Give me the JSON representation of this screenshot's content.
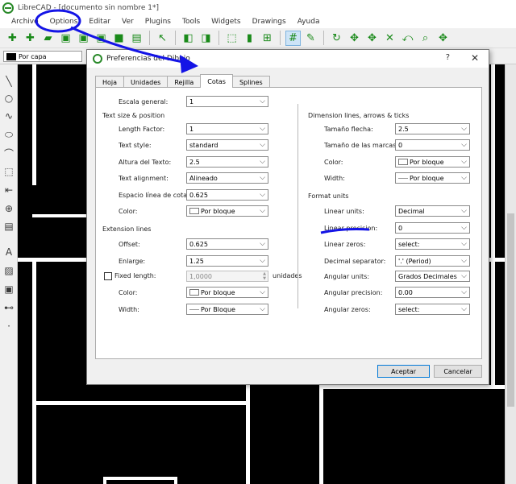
{
  "window": {
    "title": "LibreCAD - [documento sin nombre 1*]"
  },
  "menu": [
    "Archivo",
    "Options",
    "Editar",
    "Ver",
    "Plugins",
    "Tools",
    "Widgets",
    "Drawings",
    "Ayuda"
  ],
  "layer": {
    "value": "Por capa"
  },
  "dialog": {
    "title": "Preferencias del Dibujo",
    "help": "?",
    "close": "✕",
    "tabs": [
      "Hoja",
      "Unidades",
      "Rejilla",
      "Cotas",
      "Splines"
    ],
    "active_tab": "Cotas",
    "general": {
      "label": "Escala general:",
      "value": "1"
    },
    "text_section": {
      "title": "Text size & position",
      "length_factor": {
        "label": "Length Factor:",
        "value": "1"
      },
      "text_style": {
        "label": "Text style:",
        "value": "standard"
      },
      "text_height": {
        "label": "Altura del Texto:",
        "value": "2.5"
      },
      "text_alignment": {
        "label": "Text alignment:",
        "value": "Alineado"
      },
      "line_spacing": {
        "label": "Espacio línea de cota:",
        "value": "0.625"
      },
      "color": {
        "label": "Color:",
        "value": "Por bloque"
      }
    },
    "extension_section": {
      "title": "Extension lines",
      "offset": {
        "label": "Offset:",
        "value": "0.625"
      },
      "enlarge": {
        "label": "Enlarge:",
        "value": "1.25"
      },
      "fixed_length": {
        "label": "Fixed length:",
        "value": "1,0000",
        "unit": "unidades"
      },
      "color": {
        "label": "Color:",
        "value": "Por bloque"
      },
      "width": {
        "label": "Width:",
        "value": "Por Bloque"
      }
    },
    "lines_section": {
      "title": "Dimension lines, arrows & ticks",
      "arrow_size": {
        "label": "Tamaño flecha:",
        "value": "2.5"
      },
      "tick_size": {
        "label": "Tamaño de las marcas:",
        "value": "0"
      },
      "color": {
        "label": "Color:",
        "value": "Por bloque"
      },
      "width": {
        "label": "Width:",
        "value": "Por bloque"
      }
    },
    "format_section": {
      "title": "Format units",
      "linear_units": {
        "label": "Linear units:",
        "value": "Decimal"
      },
      "linear_precision": {
        "label": "Linear precision:",
        "value": "0"
      },
      "linear_zeros": {
        "label": "Linear zeros:",
        "value": "select:"
      },
      "decimal_separator": {
        "label": "Decimal separator:",
        "value": "'.' (Period)"
      },
      "angular_units": {
        "label": "Angular units:",
        "value": "Grados Decimales"
      },
      "angular_precision": {
        "label": "Angular precision:",
        "value": "0.00"
      },
      "angular_zeros": {
        "label": "Angular zeros:",
        "value": "select:"
      }
    },
    "buttons": {
      "ok": "Aceptar",
      "cancel": "Cancelar"
    }
  },
  "colors": {
    "annotation": "#1414e6",
    "canvas": "#000000",
    "accent": "#0078d7"
  }
}
